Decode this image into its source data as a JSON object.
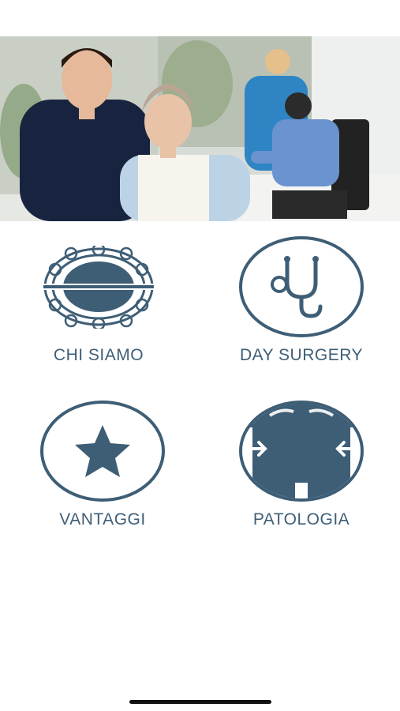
{
  "menu": {
    "items": [
      {
        "label": "CHI SIAMO",
        "icon": "crest-icon"
      },
      {
        "label": "DAY SURGERY",
        "icon": "stethoscope-icon"
      },
      {
        "label": "VANTAGGI",
        "icon": "star-icon"
      },
      {
        "label": "PATOLOGIA",
        "icon": "body-arrows-icon"
      }
    ]
  },
  "colors": {
    "icon": "#3e5e76",
    "background": "#ffffff"
  }
}
